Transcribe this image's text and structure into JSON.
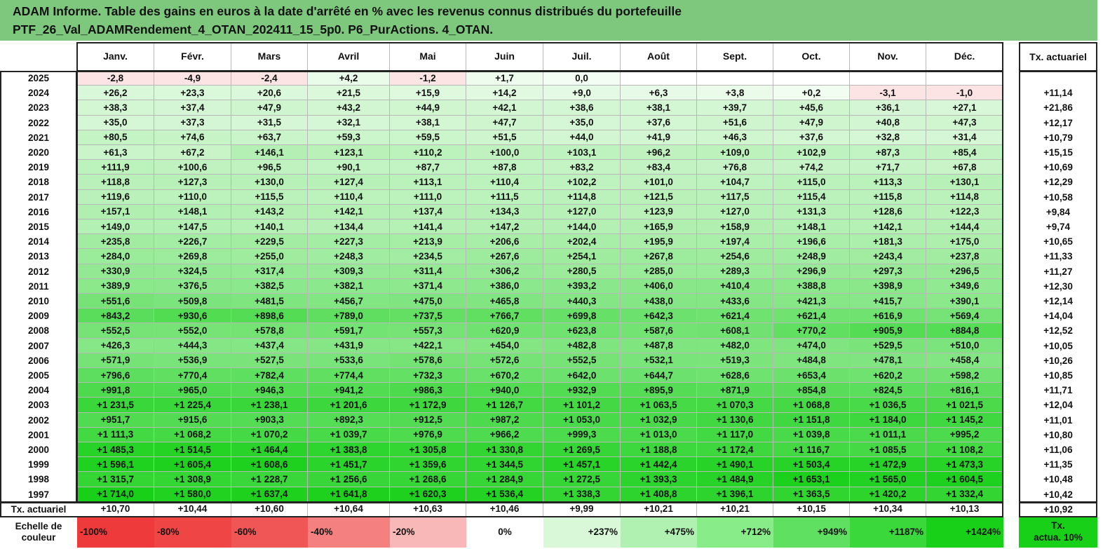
{
  "title": {
    "line1": "ADAM Informe. Table des gains en euros à la date d'arrêté en % avec les revenus connus distribués du portefeuille",
    "line2": "PTF_26_Val_ADAMRendement_4_OTAN_202411_15_5p0. P6_PurActions. 4_OTAN."
  },
  "months": [
    "Janv.",
    "Févr.",
    "Mars",
    "Avril",
    "Mai",
    "Juin",
    "Juil.",
    "Août",
    "Sept.",
    "Oct.",
    "Nov.",
    "Déc."
  ],
  "rate_header": "Tx. actuariel",
  "rows": [
    {
      "year": "2025",
      "values": [
        "-2,8",
        "-4,9",
        "-2,4",
        "+4,2",
        "-1,2",
        "+1,7",
        "0,0",
        "",
        "",
        "",
        "",
        ""
      ],
      "rate": ""
    },
    {
      "year": "2024",
      "values": [
        "+26,2",
        "+23,3",
        "+20,6",
        "+21,5",
        "+15,9",
        "+14,2",
        "+9,0",
        "+6,3",
        "+3,8",
        "+0,2",
        "-3,1",
        "-1,0"
      ],
      "rate": "+11,14"
    },
    {
      "year": "2023",
      "values": [
        "+38,3",
        "+37,4",
        "+47,9",
        "+43,2",
        "+44,9",
        "+42,1",
        "+38,6",
        "+38,1",
        "+39,7",
        "+45,6",
        "+36,1",
        "+27,1"
      ],
      "rate": "+21,86"
    },
    {
      "year": "2022",
      "values": [
        "+35,0",
        "+37,3",
        "+31,5",
        "+32,1",
        "+38,1",
        "+47,7",
        "+35,0",
        "+37,6",
        "+51,6",
        "+47,9",
        "+40,8",
        "+47,3"
      ],
      "rate": "+12,17"
    },
    {
      "year": "2021",
      "values": [
        "+80,5",
        "+74,6",
        "+63,7",
        "+59,3",
        "+59,5",
        "+51,5",
        "+44,0",
        "+41,9",
        "+46,3",
        "+37,6",
        "+32,8",
        "+31,4"
      ],
      "rate": "+10,79"
    },
    {
      "year": "2020",
      "values": [
        "+61,3",
        "+67,2",
        "+146,1",
        "+123,1",
        "+110,2",
        "+100,0",
        "+103,1",
        "+96,2",
        "+109,0",
        "+102,9",
        "+87,3",
        "+85,4"
      ],
      "rate": "+15,15"
    },
    {
      "year": "2019",
      "values": [
        "+111,9",
        "+100,6",
        "+96,5",
        "+90,1",
        "+87,7",
        "+87,8",
        "+83,2",
        "+83,4",
        "+76,8",
        "+74,2",
        "+71,7",
        "+67,8"
      ],
      "rate": "+10,69"
    },
    {
      "year": "2018",
      "values": [
        "+118,8",
        "+127,3",
        "+130,0",
        "+127,4",
        "+113,1",
        "+110,4",
        "+102,2",
        "+101,0",
        "+104,7",
        "+115,0",
        "+113,3",
        "+130,1"
      ],
      "rate": "+12,29"
    },
    {
      "year": "2017",
      "values": [
        "+119,6",
        "+110,0",
        "+115,5",
        "+110,4",
        "+111,0",
        "+111,5",
        "+114,8",
        "+121,5",
        "+117,5",
        "+115,4",
        "+115,8",
        "+114,8"
      ],
      "rate": "+10,58"
    },
    {
      "year": "2016",
      "values": [
        "+157,1",
        "+148,1",
        "+143,2",
        "+142,1",
        "+137,4",
        "+134,3",
        "+127,0",
        "+123,9",
        "+127,0",
        "+131,3",
        "+128,6",
        "+122,3"
      ],
      "rate": "+9,84"
    },
    {
      "year": "2015",
      "values": [
        "+149,0",
        "+147,5",
        "+140,1",
        "+134,4",
        "+141,4",
        "+147,2",
        "+144,0",
        "+165,9",
        "+158,9",
        "+148,1",
        "+142,1",
        "+144,4"
      ],
      "rate": "+9,74"
    },
    {
      "year": "2014",
      "values": [
        "+235,8",
        "+226,7",
        "+229,5",
        "+227,3",
        "+213,9",
        "+206,6",
        "+202,4",
        "+195,9",
        "+197,4",
        "+196,6",
        "+181,3",
        "+175,0"
      ],
      "rate": "+10,65"
    },
    {
      "year": "2013",
      "values": [
        "+284,0",
        "+269,8",
        "+255,0",
        "+248,3",
        "+234,5",
        "+267,6",
        "+254,1",
        "+267,8",
        "+254,6",
        "+248,9",
        "+243,4",
        "+237,8"
      ],
      "rate": "+11,33"
    },
    {
      "year": "2012",
      "values": [
        "+330,9",
        "+324,5",
        "+317,4",
        "+309,3",
        "+311,4",
        "+306,2",
        "+280,5",
        "+285,0",
        "+289,3",
        "+296,9",
        "+297,3",
        "+296,5"
      ],
      "rate": "+11,27"
    },
    {
      "year": "2011",
      "values": [
        "+389,9",
        "+376,5",
        "+382,5",
        "+382,1",
        "+371,4",
        "+386,0",
        "+393,2",
        "+406,0",
        "+410,4",
        "+388,8",
        "+398,9",
        "+349,6"
      ],
      "rate": "+12,30"
    },
    {
      "year": "2010",
      "values": [
        "+551,6",
        "+509,8",
        "+481,5",
        "+456,7",
        "+475,0",
        "+465,8",
        "+440,3",
        "+438,0",
        "+433,6",
        "+421,3",
        "+415,7",
        "+390,1"
      ],
      "rate": "+12,14"
    },
    {
      "year": "2009",
      "values": [
        "+843,2",
        "+930,6",
        "+898,6",
        "+789,0",
        "+737,5",
        "+766,7",
        "+699,8",
        "+642,3",
        "+621,4",
        "+621,4",
        "+616,9",
        "+569,4"
      ],
      "rate": "+14,04"
    },
    {
      "year": "2008",
      "values": [
        "+552,5",
        "+552,0",
        "+578,8",
        "+591,7",
        "+557,3",
        "+620,9",
        "+623,8",
        "+587,6",
        "+608,1",
        "+770,2",
        "+905,9",
        "+884,8"
      ],
      "rate": "+12,52"
    },
    {
      "year": "2007",
      "values": [
        "+426,3",
        "+444,3",
        "+437,4",
        "+431,9",
        "+422,1",
        "+454,0",
        "+482,8",
        "+487,8",
        "+482,0",
        "+474,0",
        "+529,5",
        "+510,0"
      ],
      "rate": "+10,05"
    },
    {
      "year": "2006",
      "values": [
        "+571,9",
        "+536,9",
        "+527,5",
        "+533,6",
        "+578,6",
        "+572,6",
        "+552,5",
        "+532,1",
        "+519,3",
        "+484,8",
        "+478,1",
        "+458,4"
      ],
      "rate": "+10,26"
    },
    {
      "year": "2005",
      "values": [
        "+796,6",
        "+770,4",
        "+782,4",
        "+774,4",
        "+732,3",
        "+670,2",
        "+642,0",
        "+644,7",
        "+628,6",
        "+653,4",
        "+620,2",
        "+598,2"
      ],
      "rate": "+10,85"
    },
    {
      "year": "2004",
      "values": [
        "+991,8",
        "+965,0",
        "+946,3",
        "+941,2",
        "+986,3",
        "+940,0",
        "+932,9",
        "+895,9",
        "+871,9",
        "+854,8",
        "+824,5",
        "+816,1"
      ],
      "rate": "+11,71"
    },
    {
      "year": "2003",
      "values": [
        "+1 231,5",
        "+1 225,4",
        "+1 238,1",
        "+1 201,6",
        "+1 172,9",
        "+1 126,7",
        "+1 101,2",
        "+1 063,5",
        "+1 070,3",
        "+1 068,8",
        "+1 036,5",
        "+1 021,5"
      ],
      "rate": "+12,04"
    },
    {
      "year": "2002",
      "values": [
        "+951,7",
        "+915,6",
        "+903,3",
        "+892,3",
        "+912,5",
        "+987,2",
        "+1 053,0",
        "+1 032,9",
        "+1 130,6",
        "+1 151,8",
        "+1 184,0",
        "+1 145,2"
      ],
      "rate": "+11,01"
    },
    {
      "year": "2001",
      "values": [
        "+1 111,3",
        "+1 068,2",
        "+1 070,2",
        "+1 039,7",
        "+976,9",
        "+966,2",
        "+999,3",
        "+1 013,0",
        "+1 117,0",
        "+1 039,8",
        "+1 011,1",
        "+995,2"
      ],
      "rate": "+10,80"
    },
    {
      "year": "2000",
      "values": [
        "+1 485,3",
        "+1 514,5",
        "+1 464,4",
        "+1 383,8",
        "+1 305,8",
        "+1 330,8",
        "+1 269,5",
        "+1 188,8",
        "+1 172,4",
        "+1 116,7",
        "+1 085,5",
        "+1 108,2"
      ],
      "rate": "+11,06"
    },
    {
      "year": "1999",
      "values": [
        "+1 596,1",
        "+1 605,4",
        "+1 608,6",
        "+1 451,7",
        "+1 359,6",
        "+1 344,5",
        "+1 457,1",
        "+1 442,4",
        "+1 490,1",
        "+1 503,4",
        "+1 472,9",
        "+1 473,3"
      ],
      "rate": "+11,35"
    },
    {
      "year": "1998",
      "values": [
        "+1 315,7",
        "+1 308,9",
        "+1 228,7",
        "+1 256,6",
        "+1 268,6",
        "+1 284,9",
        "+1 272,5",
        "+1 393,3",
        "+1 484,9",
        "+1 653,1",
        "+1 565,0",
        "+1 604,5"
      ],
      "rate": "+10,48"
    },
    {
      "year": "1997",
      "values": [
        "+1 714,0",
        "+1 580,0",
        "+1 637,4",
        "+1 641,8",
        "+1 620,3",
        "+1 536,4",
        "+1 338,3",
        "+1 408,8",
        "+1 396,1",
        "+1 363,5",
        "+1 420,2",
        "+1 332,4"
      ],
      "rate": "+10,42"
    }
  ],
  "footer_rate": {
    "label": "Tx. actuariel",
    "values": [
      "+10,70",
      "+10,44",
      "+10,60",
      "+10,64",
      "+10,63",
      "+10,46",
      "+9,99",
      "+10,21",
      "+10,21",
      "+10,15",
      "+10,34",
      "+10,13"
    ],
    "rate": "+10,92"
  },
  "scale": {
    "label_line1": "Echelle de",
    "label_line2": "couleur",
    "items": [
      {
        "label": "-100%",
        "color": "#ee3a3a"
      },
      {
        "label": "-80%",
        "color": "#f04545"
      },
      {
        "label": "-60%",
        "color": "#f05656"
      },
      {
        "label": "-40%",
        "color": "#f48080"
      },
      {
        "label": "-20%",
        "color": "#f8b8b8"
      },
      {
        "label": "0%",
        "color": "#ffffff"
      },
      {
        "label": "+237%",
        "color": "#d8f8d8"
      },
      {
        "label": "+475%",
        "color": "#b0f0b0"
      },
      {
        "label": "+712%",
        "color": "#88ec88"
      },
      {
        "label": "+949%",
        "color": "#60e060"
      },
      {
        "label": "+1187%",
        "color": "#3ad83a"
      },
      {
        "label": "+1424%",
        "color": "#18d018"
      }
    ],
    "rate_label_line1": "Tx.",
    "rate_label_line2": "actua. 10%",
    "rate_color": "#18d018"
  },
  "colors": {
    "header_bg": "#7ec87e",
    "max_green": "#18d018",
    "neg_tint": "#fde4e4"
  }
}
